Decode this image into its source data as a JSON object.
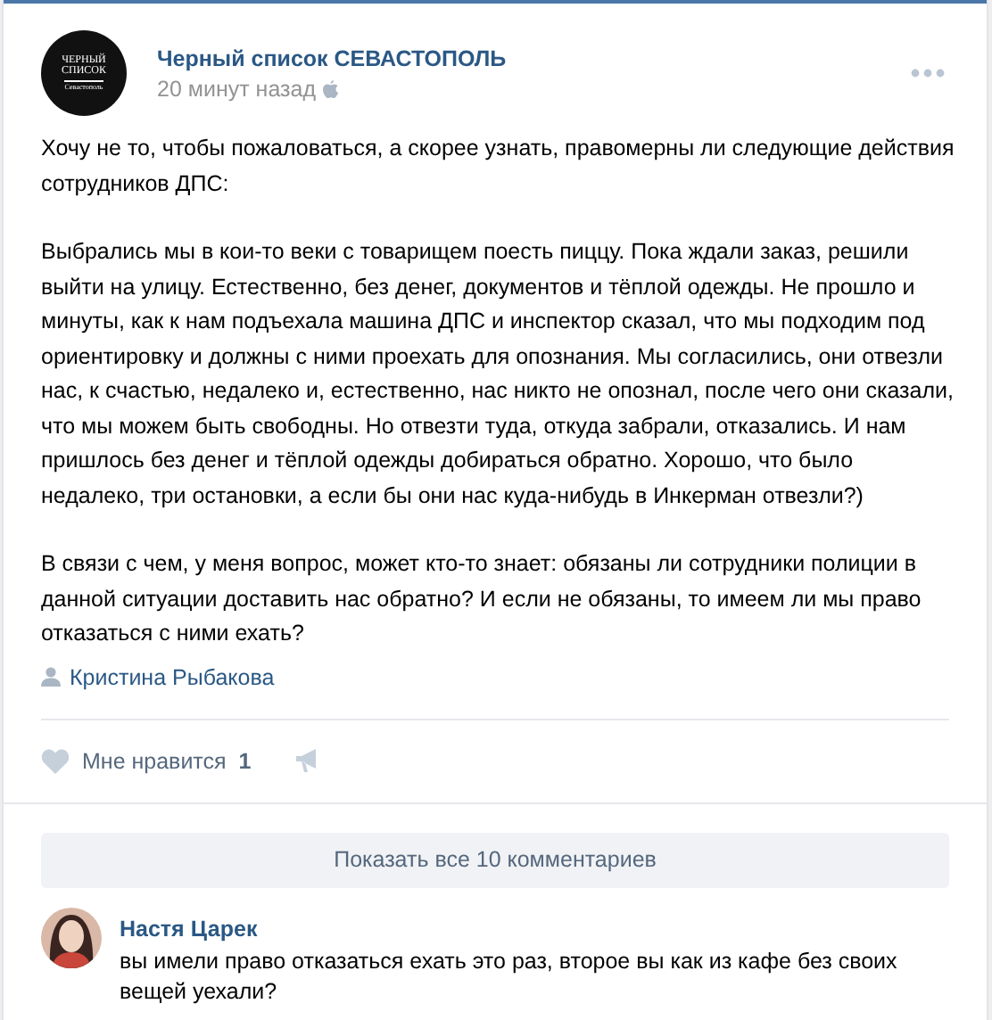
{
  "post": {
    "author": "Черный список СЕВАСТОПОЛЬ",
    "logo": [
      "ЧЕРНЫЙ",
      "СПИСОК",
      "Севастополь"
    ],
    "time": "20 минут назад",
    "paragraphs": [
      "Хочу не то, чтобы пожаловаться, а скорее узнать, правомерны ли следующие действия сотрудников ДПС:",
      "Выбрались мы в кои-то веки с товарищем поесть пиццу. Пока ждали заказ, решили выйти на улицу. Естественно, без денег, документов и тёплой одежды. Не прошло и минуты, как к нам подъехала машина ДПС и инспектор сказал, что мы подходим под ориентировку и должны с ними проехать для опознания. Мы согласились, они отвезли нас, к счастью, недалеко и, естественно, нас никто не опознал, после чего они сказали, что мы можем быть свободны. Но отвезти туда, откуда забрали, отказались. И нам пришлось без денег и тёплой одежды добираться обратно. Хорошо, что было недалеко, три остановки, а если бы они нас куда-нибудь в Инкерман отвезли?)",
      "В связи с чем, у меня вопрос, может кто-то знает: обязаны ли сотрудники полиции в данной ситуации доставить нас обратно? И если не обязаны, то имеем ли мы право отказаться с ними ехать?"
    ],
    "signer": "Кристина Рыбакова",
    "likes": {
      "label": "Мне нравится",
      "count": "1",
      "liked": false
    }
  },
  "comments": {
    "show_all": "Показать все 10 комментариев",
    "items": [
      {
        "author": "Настя Царек",
        "text": "вы имели право отказаться ехать это раз, второе вы как из кафе без своих вещей уехали?"
      }
    ]
  }
}
